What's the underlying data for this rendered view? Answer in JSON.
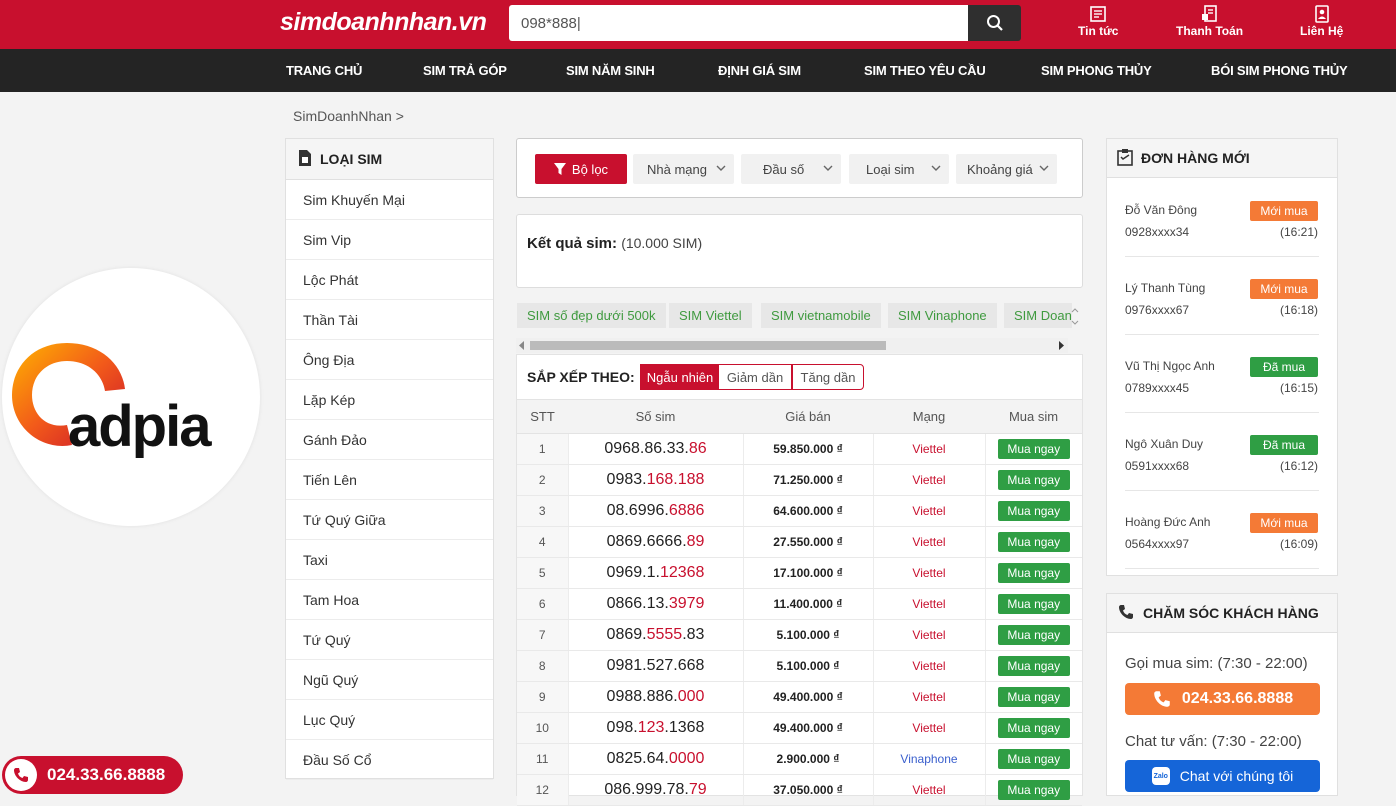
{
  "header": {
    "logo": "simdoanhnhan.vn",
    "search_value": "098*888|",
    "links": [
      {
        "label": "Tin tức",
        "icon": "news-icon"
      },
      {
        "label": "Thanh Toán",
        "icon": "payment-icon"
      },
      {
        "label": "Liên Hệ",
        "icon": "contact-icon"
      }
    ]
  },
  "nav": [
    "TRANG CHỦ",
    "SIM TRẢ GÓP",
    "SIM NĂM SINH",
    "ĐỊNH GIÁ SIM",
    "SIM THEO YÊU CẦU",
    "SIM PHONG THỦY",
    "BÓI SIM PHONG THỦY"
  ],
  "breadcrumb": "SimDoanhNhan >",
  "sidebar": {
    "title": "LOẠI SIM",
    "items": [
      "Sim Khuyến Mại",
      "Sim Vip",
      "Lộc Phát",
      "Thần Tài",
      "Ông Địa",
      "Lặp Kép",
      "Gánh Đảo",
      "Tiến Lên",
      "Tứ Quý Giữa",
      "Taxi",
      "Tam Hoa",
      "Tứ Quý",
      "Ngũ Quý",
      "Lục Quý",
      "Đầu Số Cổ"
    ]
  },
  "adpia_logo": "adpia",
  "hotline_float": "024.33.66.8888",
  "filters": {
    "main": "Bộ lọc",
    "options": [
      "Nhà mạng",
      "Đầu số",
      "Loại sim",
      "Khoảng giá"
    ]
  },
  "result": {
    "label": "Kết quả sim:",
    "count": "(10.000 SIM)"
  },
  "tags": [
    "SIM số đẹp dưới 500k",
    "SIM Viettel",
    "SIM vietnamobile",
    "SIM Vinaphone",
    "SIM Doanh"
  ],
  "sort": {
    "label": "SẮP XẾP THEO:",
    "options": [
      "Ngẫu nhiên",
      "Giảm dần",
      "Tăng dần"
    ],
    "active": "Ngẫu nhiên"
  },
  "table": {
    "headers": [
      "STT",
      "Số sim",
      "Giá bán",
      "Mạng",
      "Mua sim"
    ],
    "buy_label": "Mua ngay",
    "rows": [
      {
        "stt": "1",
        "prefix": "0968.86.33.",
        "hl": "86",
        "suffix": "",
        "price": "59.850.000 ₫",
        "net": "Viettel"
      },
      {
        "stt": "2",
        "prefix": "0983.",
        "hl": "168.188",
        "suffix": "",
        "price": "71.250.000 ₫",
        "net": "Viettel"
      },
      {
        "stt": "3",
        "prefix": "08.6996.",
        "hl": "6886",
        "suffix": "",
        "price": "64.600.000 ₫",
        "net": "Viettel"
      },
      {
        "stt": "4",
        "prefix": "0869.6666.",
        "hl": "89",
        "suffix": "",
        "price": "27.550.000 ₫",
        "net": "Viettel"
      },
      {
        "stt": "5",
        "prefix": "0969.1.",
        "hl": "12368",
        "suffix": "",
        "price": "17.100.000 ₫",
        "net": "Viettel"
      },
      {
        "stt": "6",
        "prefix": "0866.13.",
        "hl": "3979",
        "suffix": "",
        "price": "11.400.000 ₫",
        "net": "Viettel"
      },
      {
        "stt": "7",
        "prefix": "0869.",
        "hl": "5555",
        "suffix": ".83",
        "price": "5.100.000 ₫",
        "net": "Viettel"
      },
      {
        "stt": "8",
        "prefix": "0981.527.668",
        "hl": "",
        "suffix": "",
        "price": "5.100.000 ₫",
        "net": "Viettel"
      },
      {
        "stt": "9",
        "prefix": "0988.886.",
        "hl": "000",
        "suffix": "",
        "price": "49.400.000 ₫",
        "net": "Viettel"
      },
      {
        "stt": "10",
        "prefix": "098.",
        "hl": "123",
        "suffix": ".1368",
        "price": "49.400.000 ₫",
        "net": "Viettel"
      },
      {
        "stt": "11",
        "prefix": "0825.64.",
        "hl": "0000",
        "suffix": "",
        "price": "2.900.000 ₫",
        "net": "Vinaphone"
      },
      {
        "stt": "12",
        "prefix": "086.999.78.",
        "hl": "79",
        "suffix": "",
        "price": "37.050.000 ₫",
        "net": "Viettel"
      }
    ]
  },
  "orders": {
    "title": "ĐƠN HÀNG MỚI",
    "items": [
      {
        "name": "Đỗ Văn Đông",
        "phone": "0928xxxx34",
        "status": "Mới mua",
        "type": "new",
        "time": "(16:21)"
      },
      {
        "name": "Lý Thanh Tùng",
        "phone": "0976xxxx67",
        "status": "Mới mua",
        "type": "new",
        "time": "(16:18)"
      },
      {
        "name": "Vũ Thị Ngọc Anh",
        "phone": "0789xxxx45",
        "status": "Đã mua",
        "type": "done",
        "time": "(16:15)"
      },
      {
        "name": "Ngô Xuân Duy",
        "phone": "0591xxxx68",
        "status": "Đã mua",
        "type": "done",
        "time": "(16:12)"
      },
      {
        "name": "Hoàng Đức Anh",
        "phone": "0564xxxx97",
        "status": "Mới mua",
        "type": "new",
        "time": "(16:09)"
      }
    ]
  },
  "support": {
    "title": "CHĂM SÓC KHÁCH HÀNG",
    "call_hours": "Gọi mua sim: (7:30 - 22:00)",
    "call_number": "024.33.66.8888",
    "chat_hours": "Chat tư vấn: (7:30 - 22:00)",
    "chat_button": "Chat với chúng tôi",
    "chat_icon_text": "Zalo"
  },
  "colors": {
    "brand_red": "#c8102e",
    "green": "#2f9e44",
    "orange": "#f47a36",
    "blue": "#1565d8"
  }
}
